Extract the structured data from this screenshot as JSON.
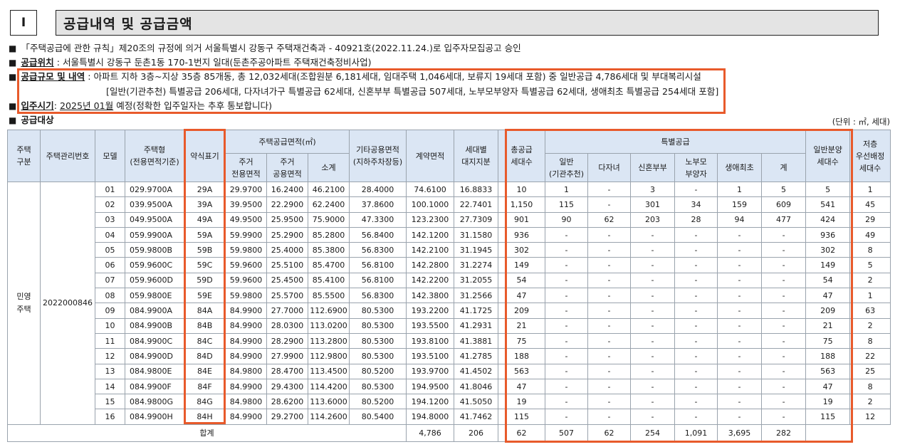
{
  "section": {
    "number": "I",
    "title": "공급내역 및 공급금액"
  },
  "approval": {
    "bullet": "■",
    "text": "「주택공급에 관한 규칙」제20조의 규정에 의거 서울특별시 강동구 주택재건축과 - 40921호(2022.11.24.)로 입주자모집공고 승인"
  },
  "location": {
    "bullet": "■",
    "label": "공급위치",
    "text": " : 서울특별시 강동구 둔촌1동 170-1번지 일대(둔촌주공아파트 주택재건축정비사업)"
  },
  "scale": {
    "bullet": "■",
    "label": "공급규모 및 내역",
    "line1": " : 아파트 지하 3층~지상 35층 85개동, 총 12,032세대(조합원분 6,181세대, 임대주택 1,046세대, 보류지 19세대 포함) 중 일반공급 4,786세대 및 부대복리시설",
    "line2": "[일반(기관추천) 특별공급 206세대, 다자녀가구 특별공급 62세대, 신혼부부 특별공급 507세대, 노부모부양자 특별공급 62세대, 생애최초 특별공급 254세대 포함]"
  },
  "movein": {
    "bullet": "■",
    "label": "입주시기",
    "sep": ": ",
    "date": "2025년 01월",
    "text": " 예정(정확한 입주일자는 추후 통보합니다)"
  },
  "target": {
    "bullet": "■",
    "label": "공급대상"
  },
  "unit_note": "(단위 : ㎡, 세대)",
  "headers": {
    "housing_type_1": "주택",
    "housing_type_2": "구분",
    "mgmt_no": "주택관리번호",
    "model": "모델",
    "house_type_1": "주택형",
    "house_type_2": "(전용면적기준)",
    "short_label": "약식표기",
    "supply_area": "주택공급면적(㎡)",
    "exclusive_1": "주거",
    "exclusive_2": "전용면적",
    "common_1": "주거",
    "common_2": "공용면적",
    "subtotal": "소계",
    "other_common_1": "기타공용면적",
    "other_common_2": "(지하주차장등)",
    "contract_area": "계약면적",
    "land_share_1": "세대별",
    "land_share_2": "대지지분",
    "total_supply_1": "총공급",
    "total_supply_2": "세대수",
    "special": "특별공급",
    "sp_general_1": "일반",
    "sp_general_2": "(기관추천)",
    "sp_multichild": "다자녀",
    "sp_newlywed": "신혼부부",
    "sp_elderly_1": "노부모",
    "sp_elderly_2": "부양자",
    "sp_firsttime": "생애최초",
    "sp_sum": "계",
    "general_1": "일반분양",
    "general_2": "세대수",
    "low_floor_1": "저층",
    "low_floor_2": "우선배정",
    "low_floor_3": "세대수"
  },
  "group": {
    "type_1": "민영",
    "type_2": "주택",
    "mgmt_no": "2022000846"
  },
  "rows": [
    [
      "01",
      "029.9700A",
      "29A",
      "29.9700",
      "16.2400",
      "46.2100",
      "28.4000",
      "74.6100",
      "16.8833",
      "10",
      "1",
      "-",
      "3",
      "-",
      "1",
      "5",
      "5",
      "1"
    ],
    [
      "02",
      "039.9500A",
      "39A",
      "39.9500",
      "22.2900",
      "62.2400",
      "37.8600",
      "100.1000",
      "22.7401",
      "1,150",
      "115",
      "-",
      "301",
      "34",
      "159",
      "609",
      "541",
      "45"
    ],
    [
      "03",
      "049.9500A",
      "49A",
      "49.9500",
      "25.9500",
      "75.9000",
      "47.3300",
      "123.2300",
      "27.7309",
      "901",
      "90",
      "62",
      "203",
      "28",
      "94",
      "477",
      "424",
      "29"
    ],
    [
      "04",
      "059.9900A",
      "59A",
      "59.9900",
      "25.2900",
      "85.2800",
      "56.8400",
      "142.1200",
      "31.1580",
      "936",
      "-",
      "-",
      "-",
      "-",
      "-",
      "-",
      "936",
      "49"
    ],
    [
      "05",
      "059.9800B",
      "59B",
      "59.9800",
      "25.4000",
      "85.3800",
      "56.8300",
      "142.2100",
      "31.1945",
      "302",
      "-",
      "-",
      "-",
      "-",
      "-",
      "-",
      "302",
      "8"
    ],
    [
      "06",
      "059.9600C",
      "59C",
      "59.9600",
      "25.5100",
      "85.4700",
      "56.8100",
      "142.2800",
      "31.2274",
      "149",
      "-",
      "-",
      "-",
      "-",
      "-",
      "-",
      "149",
      "5"
    ],
    [
      "07",
      "059.9600D",
      "59D",
      "59.9600",
      "25.4500",
      "85.4100",
      "56.8100",
      "142.2200",
      "31.2055",
      "54",
      "-",
      "-",
      "-",
      "-",
      "-",
      "-",
      "54",
      "2"
    ],
    [
      "08",
      "059.9800E",
      "59E",
      "59.9800",
      "25.5700",
      "85.5500",
      "56.8300",
      "142.3800",
      "31.2566",
      "47",
      "-",
      "-",
      "-",
      "-",
      "-",
      "-",
      "47",
      "1"
    ],
    [
      "09",
      "084.9900A",
      "84A",
      "84.9900",
      "27.7000",
      "112.6900",
      "80.5300",
      "193.2200",
      "41.1725",
      "209",
      "-",
      "-",
      "-",
      "-",
      "-",
      "-",
      "209",
      "63"
    ],
    [
      "10",
      "084.9900B",
      "84B",
      "84.9900",
      "28.0300",
      "113.0200",
      "80.5300",
      "193.5500",
      "41.2931",
      "21",
      "-",
      "-",
      "-",
      "-",
      "-",
      "-",
      "21",
      "2"
    ],
    [
      "11",
      "084.9900C",
      "84C",
      "84.9900",
      "28.2900",
      "113.2800",
      "80.5300",
      "193.8100",
      "41.3881",
      "75",
      "-",
      "-",
      "-",
      "-",
      "-",
      "-",
      "75",
      "8"
    ],
    [
      "12",
      "084.9900D",
      "84D",
      "84.9900",
      "27.9900",
      "112.9800",
      "80.5300",
      "193.5100",
      "41.2785",
      "188",
      "-",
      "-",
      "-",
      "-",
      "-",
      "-",
      "188",
      "22"
    ],
    [
      "13",
      "084.9800E",
      "84E",
      "84.9800",
      "28.4700",
      "113.4500",
      "80.5200",
      "193.9700",
      "41.4502",
      "563",
      "-",
      "-",
      "-",
      "-",
      "-",
      "-",
      "563",
      "25"
    ],
    [
      "14",
      "084.9900F",
      "84F",
      "84.9900",
      "29.4300",
      "114.4200",
      "80.5300",
      "194.9500",
      "41.8046",
      "47",
      "-",
      "-",
      "-",
      "-",
      "-",
      "-",
      "47",
      "8"
    ],
    [
      "15",
      "084.9800G",
      "84G",
      "84.9800",
      "28.6200",
      "113.6000",
      "80.5200",
      "194.1200",
      "41.5050",
      "19",
      "-",
      "-",
      "-",
      "-",
      "-",
      "-",
      "19",
      "2"
    ],
    [
      "16",
      "084.9900H",
      "84H",
      "84.9900",
      "29.2700",
      "114.2600",
      "80.5400",
      "194.8000",
      "41.7462",
      "115",
      "-",
      "-",
      "-",
      "-",
      "-",
      "-",
      "115",
      "12"
    ]
  ],
  "total": {
    "label": "합계",
    "total_supply": "4,786",
    "sp_general": "206",
    "sp_multichild": "62",
    "sp_newlywed": "507",
    "sp_elderly": "62",
    "sp_firsttime": "254",
    "sp_sum": "1,091",
    "general": "3,695",
    "low_floor": "282"
  },
  "colors": {
    "highlight": "#e85a2b",
    "header_bg": "#dbe6f4",
    "title_bg": "#e4e4e4"
  }
}
